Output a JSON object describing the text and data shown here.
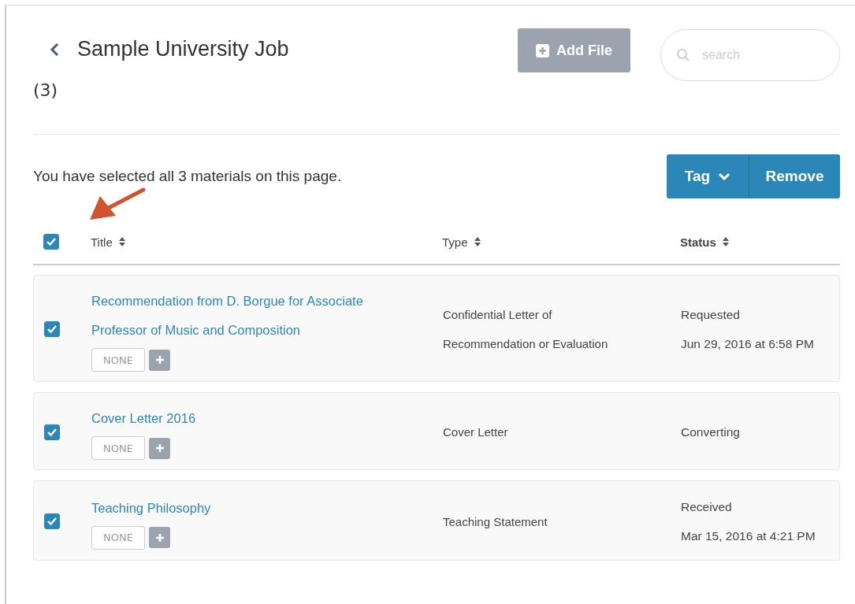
{
  "header": {
    "title": "Sample University Job",
    "count": "(3)",
    "add_button": "Add File",
    "search": {
      "placeholder": "search"
    }
  },
  "selection_message": "You have selected all 3 materials on this page.",
  "actions": {
    "tag": "Tag",
    "remove": "Remove"
  },
  "annotation": {
    "kind": "arrow"
  },
  "table": {
    "select_all": {
      "checked": true
    },
    "columns": [
      "Title",
      "Type",
      "Status"
    ],
    "rows": [
      {
        "checked": true,
        "title": "Recommendation from D. Borgue for Associate Professor of Music and Composition",
        "tag": "NONE",
        "type": "Confidential Letter of Recommendation or Evaluation",
        "status": "Requested",
        "date": "Jun 29, 2016 at 6:58 PM"
      },
      {
        "checked": true,
        "title": "Cover Letter 2016",
        "tag": "NONE",
        "type": "Cover Letter",
        "status": "Converting"
      },
      {
        "checked": true,
        "title": "Teaching Philosophy",
        "tag": "NONE",
        "type": "Teaching Statement",
        "status": "Received",
        "date": "Mar 15, 2016 at 4:21 PM"
      }
    ]
  }
}
